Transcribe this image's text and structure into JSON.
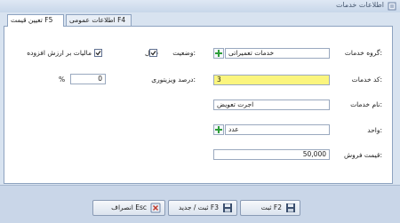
{
  "window": {
    "title": "اطلاعات خدمات"
  },
  "tabs": {
    "active": "تعیین قیمت F5",
    "inactive": "اطلاعات عمومی F4"
  },
  "form": {
    "service_group_label": "گروه خدمات:",
    "service_group_value": "خدمات تعمیراتی",
    "status_label": "وضعیت:",
    "active_label": "فعال",
    "vat_label": "مالیات بر ارزش افزوده",
    "service_code_label": "کد خدمات:",
    "service_code_value": "3",
    "visitor_percent_label": "درصد ویزیتوری:",
    "visitor_percent_value": "0",
    "percent_sign": "%",
    "service_name_label": "نام خدمات:",
    "service_name_value": "اجرت تعویض",
    "unit_label": "واحد:",
    "unit_value": "عدد",
    "sale_price_label": "قیمت فروش:",
    "sale_price_value": "50,000"
  },
  "footer": {
    "save_label": "ثبت F2",
    "save_new_label": "ثبت / جدید F3",
    "cancel_label": "انصراف Esc"
  },
  "colors": {
    "code_field_bg": "#fbf57e",
    "plus_green": "#2e9e3a",
    "cancel_red": "#c0392b"
  },
  "icons": {
    "title": "document-icon",
    "plus": "plus-icon",
    "save": "floppy-disk-icon",
    "cancel": "cancel-icon",
    "check": "checkmark-icon"
  }
}
